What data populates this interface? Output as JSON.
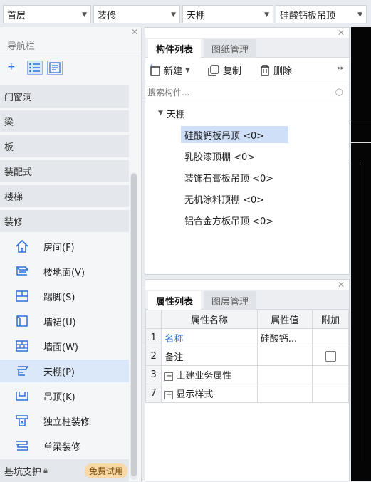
{
  "toolbar": {
    "floor": "首层",
    "category": "装修",
    "element_type": "天棚",
    "subtype": "硅酸钙板吊顶"
  },
  "nav": {
    "title": "导航栏",
    "categories": [
      "门窗洞",
      "梁",
      "板",
      "装配式",
      "楼梯",
      "装修"
    ],
    "subitems": [
      {
        "label": "房间(F)",
        "icon": "house-icon"
      },
      {
        "label": "楼地面(V)",
        "icon": "floor-icon"
      },
      {
        "label": "踢脚(S)",
        "icon": "skirting-icon"
      },
      {
        "label": "墙裙(U)",
        "icon": "wainscot-icon"
      },
      {
        "label": "墙面(W)",
        "icon": "wall-face-icon"
      },
      {
        "label": "天棚(P)",
        "icon": "ceiling-icon"
      },
      {
        "label": "吊顶(K)",
        "icon": "suspended-ceiling-icon"
      },
      {
        "label": "独立柱装修",
        "icon": "column-decor-icon"
      },
      {
        "label": "单梁装修",
        "icon": "beam-decor-icon"
      }
    ],
    "bottom_item": "基坑支护",
    "trial_badge": "免费试用",
    "selected_subitem": "天棚(P)"
  },
  "component_list": {
    "tabs": [
      "构件列表",
      "图纸管理"
    ],
    "active_tab": "构件列表",
    "actions": {
      "new": "新建",
      "copy": "复制",
      "delete": "删除"
    },
    "search_placeholder": "搜索构件...",
    "tree_root": "天棚",
    "items": [
      "硅酸钙板吊顶 <0>",
      "乳胶漆顶棚 <0>",
      "装饰石膏板吊顶 <0>",
      "无机涂料顶棚 <0>",
      "铝合金方板吊顶 <0>"
    ],
    "selected_item": "硅酸钙板吊顶 <0>"
  },
  "properties": {
    "tabs": [
      "属性列表",
      "图层管理"
    ],
    "active_tab": "属性列表",
    "headers": [
      "属性名称",
      "属性值",
      "附加"
    ],
    "rows": [
      {
        "num": "1",
        "name": "名称",
        "value": "硅酸钙...",
        "extra": ""
      },
      {
        "num": "2",
        "name": "备注",
        "value": "",
        "extra": "checkbox"
      },
      {
        "num": "3",
        "name": "土建业务属性",
        "value": "",
        "extra": "",
        "expandable": true
      },
      {
        "num": "7",
        "name": "显示样式",
        "value": "",
        "extra": "",
        "expandable": true
      }
    ]
  },
  "colors": {
    "accent": "#2f6fd6",
    "selected_bg": "#dbe8fa",
    "badge": "#f7d8a6"
  }
}
